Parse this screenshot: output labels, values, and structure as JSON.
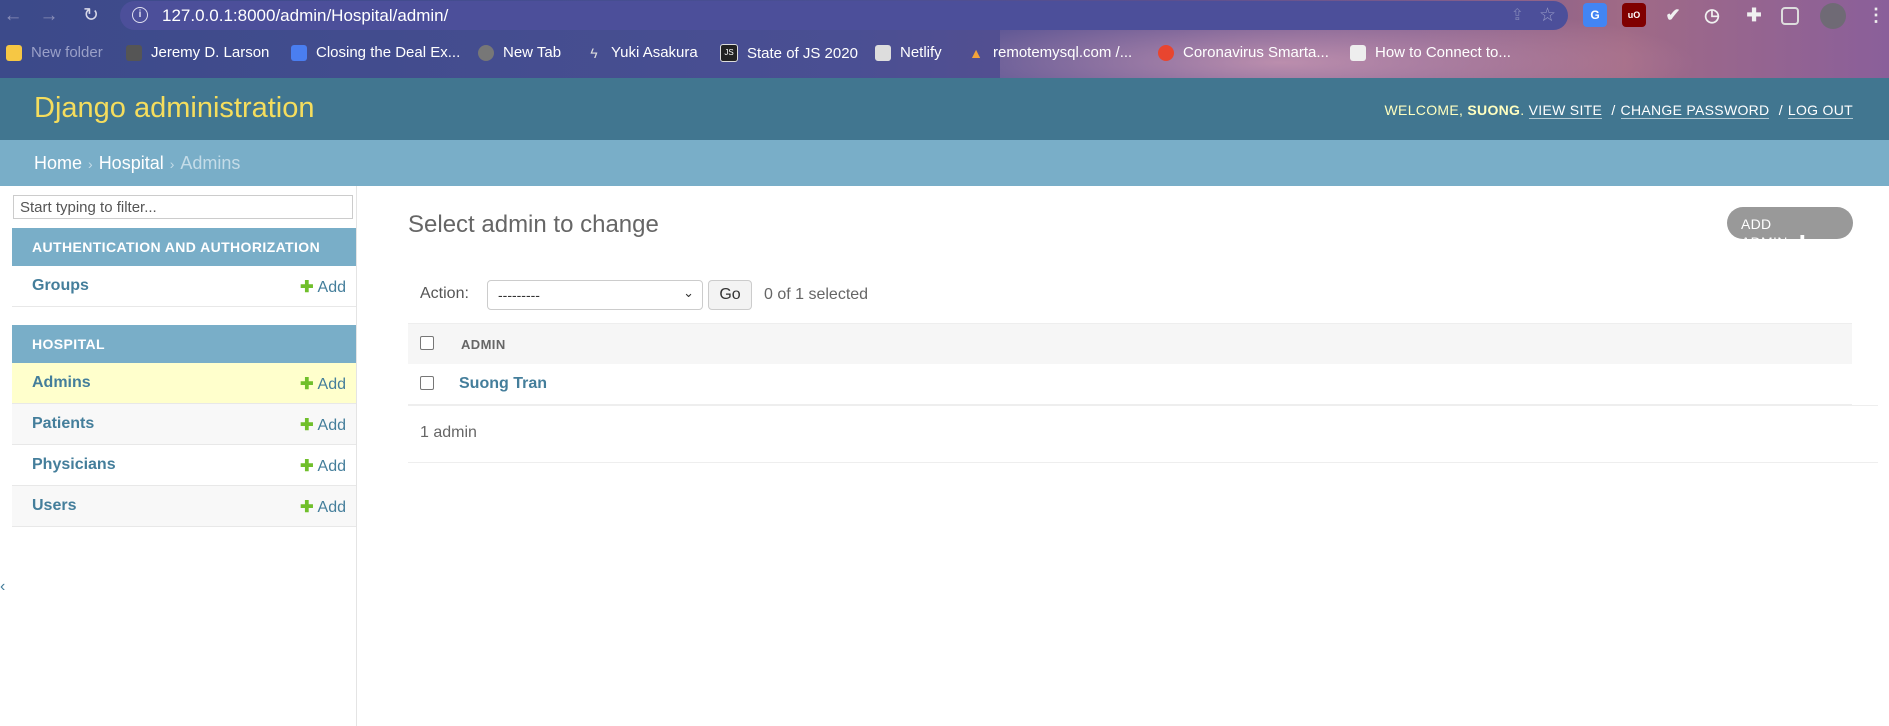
{
  "browser": {
    "url": "127.0.0.1:8000/admin/Hospital/admin/",
    "bookmarks": [
      {
        "label": "New folder",
        "icon": "folder-icon"
      },
      {
        "label": "Jeremy D. Larson",
        "icon": "cube-icon"
      },
      {
        "label": "Closing the Deal Ex...",
        "icon": "docs-icon"
      },
      {
        "label": "New Tab",
        "icon": "globe-icon"
      },
      {
        "label": "Yuki Asakura",
        "icon": "feather-icon"
      },
      {
        "label": "State of JS 2020",
        "icon": "js-icon"
      },
      {
        "label": "Netlify",
        "icon": "card-icon"
      },
      {
        "label": "remotemysql.com /...",
        "icon": "sail-icon"
      },
      {
        "label": "Coronavirus Smarta...",
        "icon": "virus-icon"
      },
      {
        "label": "How to Connect to...",
        "icon": "disk-icon"
      }
    ],
    "js_badge": "JS",
    "ublock_badge": "uO"
  },
  "header": {
    "branding": "Django administration",
    "welcome": "WELCOME,",
    "username": "SUONG",
    "period": ".",
    "view_site": "VIEW SITE",
    "change_password": "CHANGE PASSWORD",
    "logout": "LOG OUT",
    "separator": "/"
  },
  "breadcrumbs": {
    "home": "Home",
    "app": "Hospital",
    "current": "Admins",
    "chevron": "›"
  },
  "sidebar": {
    "filter_placeholder": "Start typing to filter...",
    "modules": [
      {
        "caption": "AUTHENTICATION AND AUTHORIZATION",
        "models": [
          {
            "name": "Groups",
            "add": "Add"
          }
        ]
      },
      {
        "caption": "HOSPITAL",
        "models": [
          {
            "name": "Admins",
            "add": "Add"
          },
          {
            "name": "Patients",
            "add": "Add"
          },
          {
            "name": "Physicians",
            "add": "Add"
          },
          {
            "name": "Users",
            "add": "Add"
          }
        ]
      }
    ],
    "collapse_glyph": "‹"
  },
  "content": {
    "title": "Select admin to change",
    "add_button": "ADD ADMIN",
    "action_label": "Action:",
    "action_selected": "---------",
    "go_label": "Go",
    "selection_counter": "0 of 1 selected",
    "column_header": "ADMIN",
    "rows": [
      {
        "name": "Suong Tran"
      }
    ],
    "paginator": "1 admin"
  },
  "colors": {
    "header_bg": "#417690",
    "branding": "#f5dd5d",
    "breadcrumbs_bg": "#79aec8",
    "link": "#447e9b",
    "add_plus": "#70bf2b",
    "current_row": "#ffffcc"
  }
}
